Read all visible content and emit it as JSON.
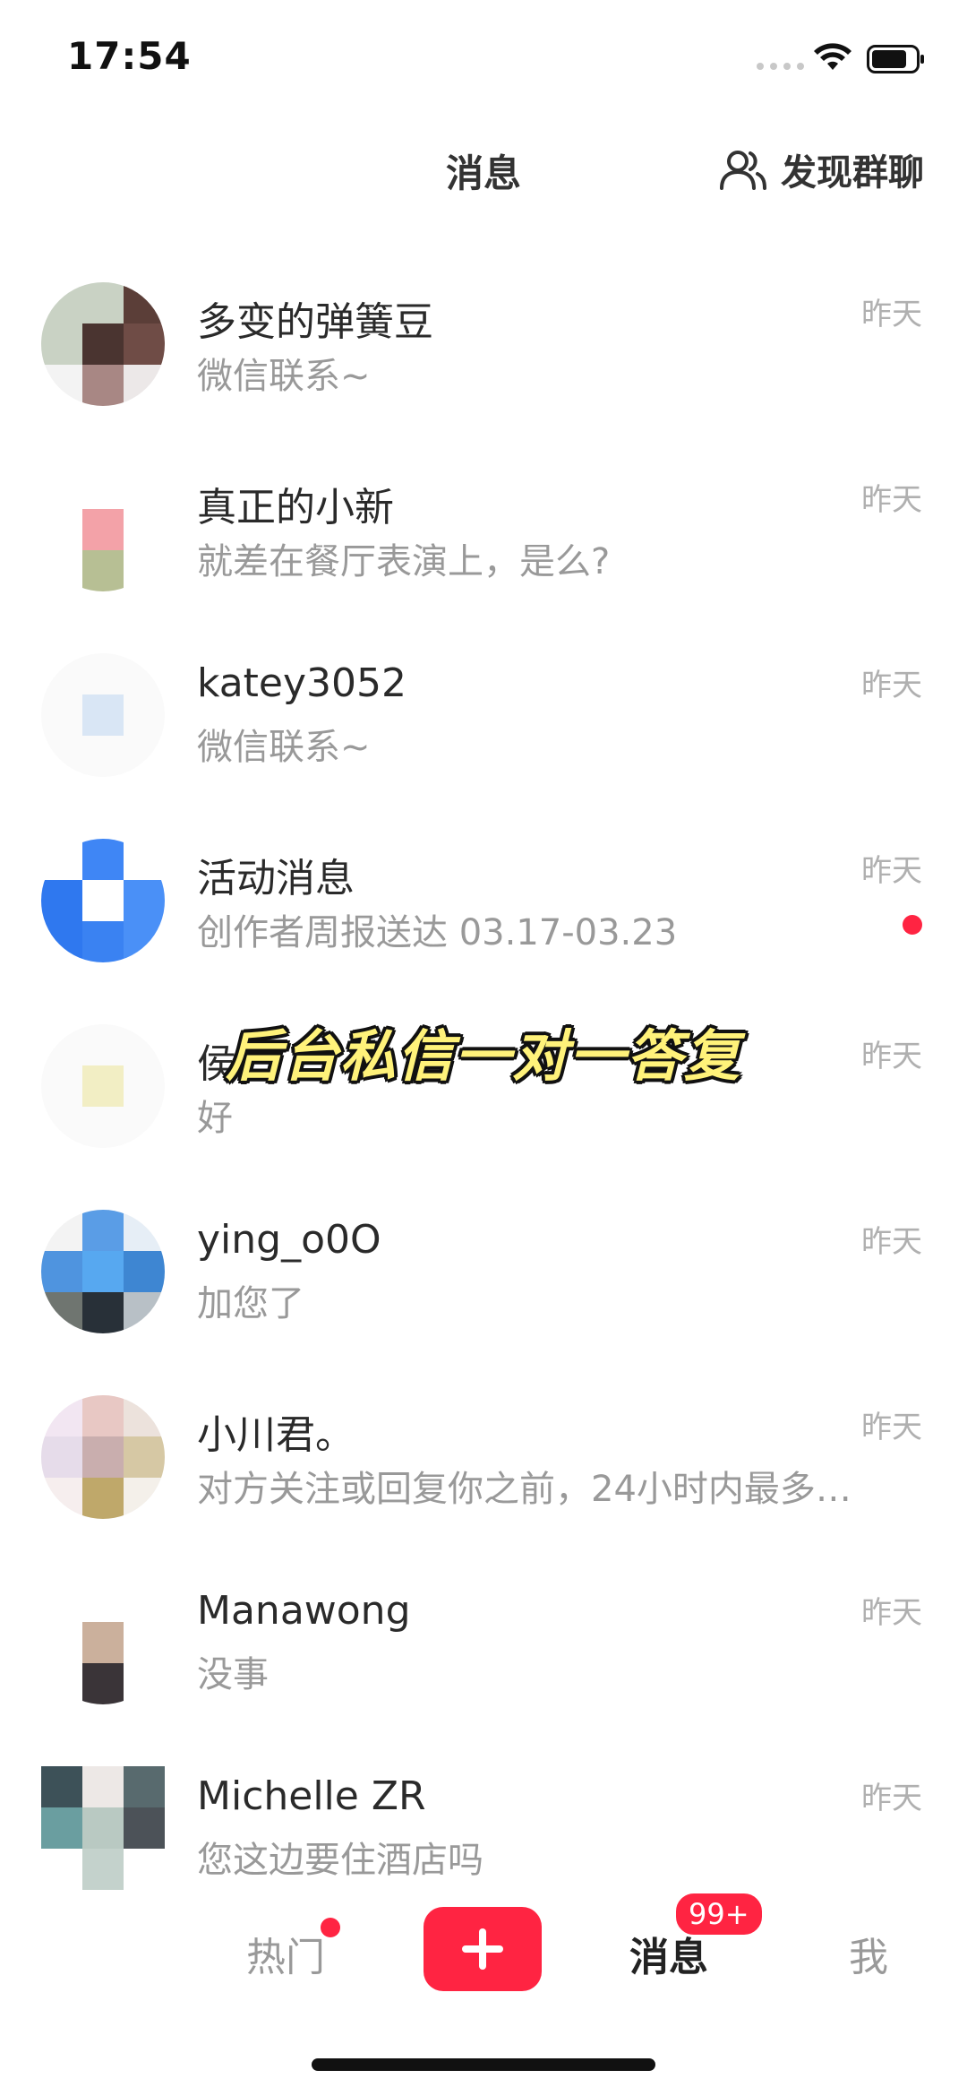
{
  "status_bar": {
    "time": "17:54"
  },
  "header": {
    "title": "消息",
    "find_group_label": "发现群聊"
  },
  "conversations": [
    {
      "name": "多变的弹簧豆",
      "preview": "微信联系~",
      "time": "昨天",
      "unread": false
    },
    {
      "name": "真正的小新",
      "preview": "就差在餐厅表演上，是么?",
      "time": "昨天",
      "unread": false
    },
    {
      "name": "katey3052",
      "preview": "微信联系~",
      "time": "昨天",
      "unread": false
    },
    {
      "name": "活动消息",
      "preview": "创作者周报送达 03.17-03.23",
      "time": "昨天",
      "unread": true
    },
    {
      "name": "侯",
      "preview": "好",
      "time": "昨天",
      "unread": false
    },
    {
      "name": "ying_o0O",
      "preview": "加您了",
      "time": "昨天",
      "unread": false
    },
    {
      "name": "小川君。",
      "preview": "对方关注或回复你之前，24小时内最多…",
      "time": "昨天",
      "unread": false
    },
    {
      "name": "Manawong",
      "preview": "没事",
      "time": "昨天",
      "unread": false
    },
    {
      "name": "Michelle ZR",
      "preview": "您这边要住酒店吗",
      "time": "昨天",
      "unread": false
    }
  ],
  "overlay_caption": "后台私信一对一答复",
  "tabbar": {
    "hot_label": "热门",
    "messages_label": "消息",
    "messages_badge": "99+",
    "me_label": "我"
  },
  "colors": {
    "accent": "#ff2442",
    "caption": "#fff27a"
  }
}
